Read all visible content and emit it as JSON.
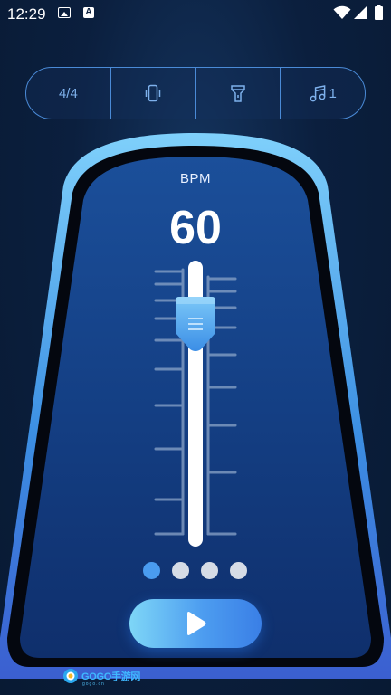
{
  "status_bar": {
    "time": "12:29",
    "icons": [
      "image-icon",
      "text-a-icon",
      "wifi-icon",
      "cellular-icon",
      "battery-icon"
    ]
  },
  "toolbar": {
    "time_signature": "4/4",
    "vibrate_icon": "vibrate-icon",
    "flashlight_icon": "flashlight-icon",
    "sound_icon": "music-note-icon",
    "sound_value": "1"
  },
  "metronome": {
    "bpm_label": "BPM",
    "bpm_value": "60"
  },
  "pager": {
    "page_count": 4,
    "active_index": 0
  },
  "controls": {
    "play_icon": "play-icon"
  },
  "watermark": {
    "brand": "GOGO手游网",
    "domain": "gogo.cn"
  },
  "colors": {
    "accent": "#4a9cf0",
    "frame": "#6fc2f5",
    "background": "#0b1f3e"
  }
}
